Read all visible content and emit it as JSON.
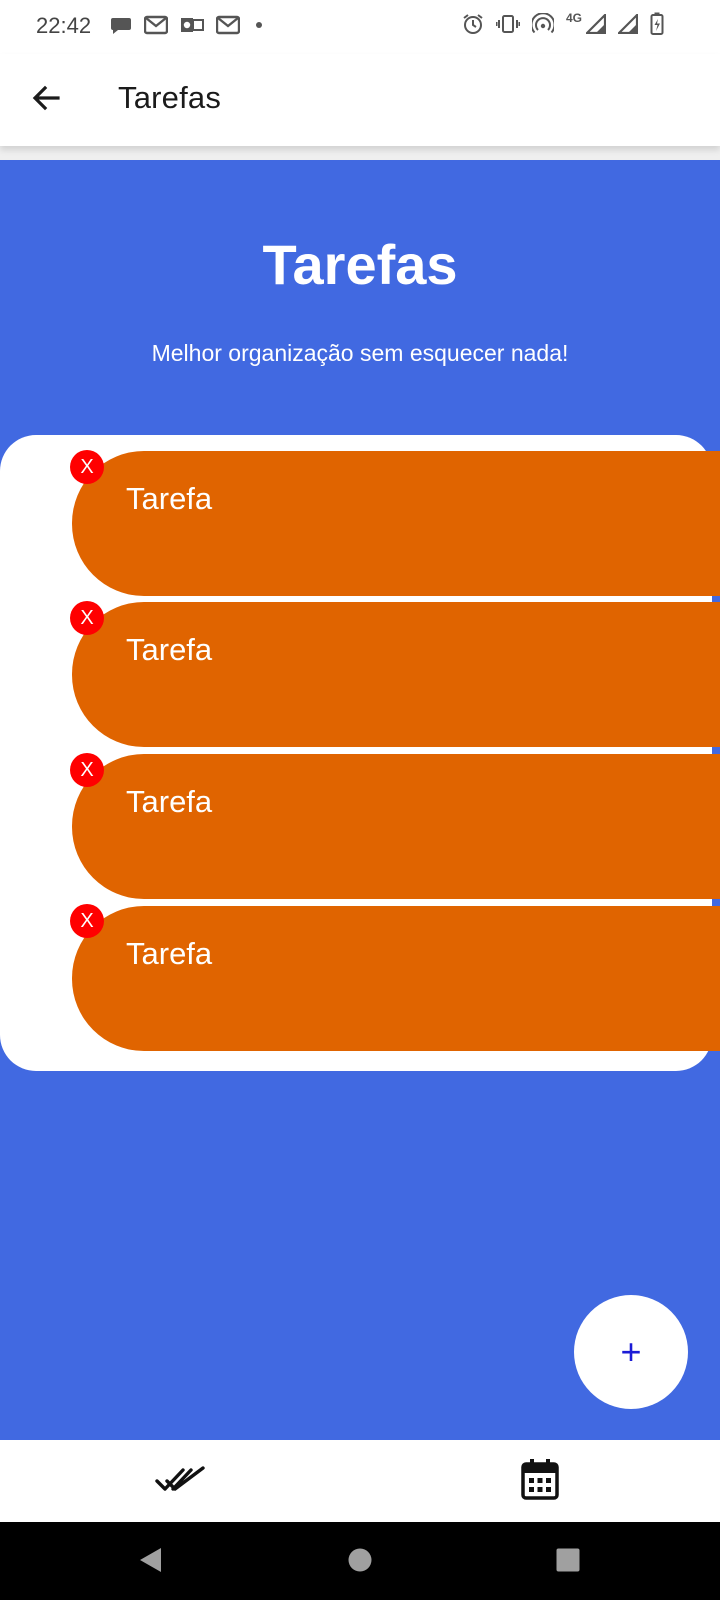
{
  "status_bar": {
    "time": "22:42",
    "network": "4G",
    "left_icons": [
      "chat-icon",
      "gmail-icon",
      "outlook-icon",
      "gmail-icon",
      "dot-icon"
    ],
    "right_icons": [
      "alarm-icon",
      "vibrate-icon",
      "hotspot-icon",
      "signal-icon",
      "signal-icon",
      "battery-charging-icon"
    ]
  },
  "app_bar": {
    "title": "Tarefas",
    "back_icon": "arrow-back-icon"
  },
  "hero": {
    "title": "Tarefas",
    "subtitle": "Melhor organização sem esquecer nada!"
  },
  "tasks": [
    {
      "label": "Tarefa",
      "delete_label": "X"
    },
    {
      "label": "Tarefa",
      "delete_label": "X"
    },
    {
      "label": "Tarefa",
      "delete_label": "X"
    },
    {
      "label": "Tarefa",
      "delete_label": "X"
    }
  ],
  "fab": {
    "label": "+"
  },
  "bottom_nav": {
    "items": [
      {
        "icon": "done-all-icon"
      },
      {
        "icon": "calendar-icon"
      }
    ]
  },
  "system_nav": {
    "items": [
      {
        "icon": "back-triangle-icon"
      },
      {
        "icon": "home-circle-icon"
      },
      {
        "icon": "recents-square-icon"
      }
    ]
  },
  "colors": {
    "primary_blue": "#4169e1",
    "task_orange": "#e06400",
    "delete_red": "#ff0000",
    "fab_plus": "#1b1bd6"
  }
}
